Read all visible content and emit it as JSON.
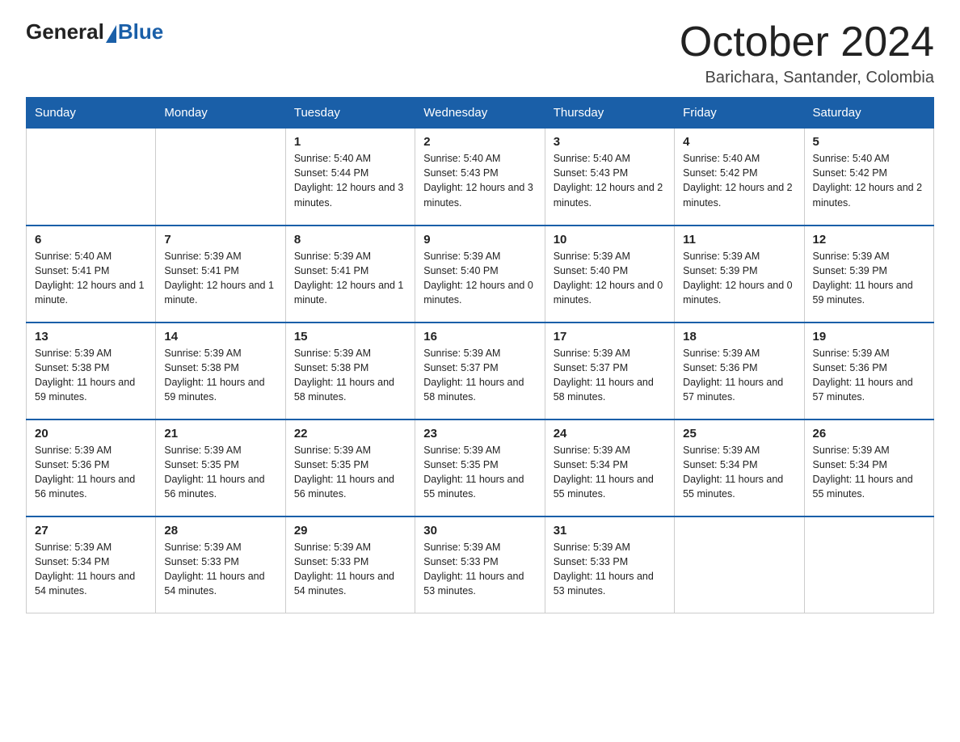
{
  "logo": {
    "general": "General",
    "blue": "Blue"
  },
  "title": "October 2024",
  "location": "Barichara, Santander, Colombia",
  "weekdays": [
    "Sunday",
    "Monday",
    "Tuesday",
    "Wednesday",
    "Thursday",
    "Friday",
    "Saturday"
  ],
  "weeks": [
    [
      {
        "day": "",
        "sunrise": "",
        "sunset": "",
        "daylight": ""
      },
      {
        "day": "",
        "sunrise": "",
        "sunset": "",
        "daylight": ""
      },
      {
        "day": "1",
        "sunrise": "Sunrise: 5:40 AM",
        "sunset": "Sunset: 5:44 PM",
        "daylight": "Daylight: 12 hours and 3 minutes."
      },
      {
        "day": "2",
        "sunrise": "Sunrise: 5:40 AM",
        "sunset": "Sunset: 5:43 PM",
        "daylight": "Daylight: 12 hours and 3 minutes."
      },
      {
        "day": "3",
        "sunrise": "Sunrise: 5:40 AM",
        "sunset": "Sunset: 5:43 PM",
        "daylight": "Daylight: 12 hours and 2 minutes."
      },
      {
        "day": "4",
        "sunrise": "Sunrise: 5:40 AM",
        "sunset": "Sunset: 5:42 PM",
        "daylight": "Daylight: 12 hours and 2 minutes."
      },
      {
        "day": "5",
        "sunrise": "Sunrise: 5:40 AM",
        "sunset": "Sunset: 5:42 PM",
        "daylight": "Daylight: 12 hours and 2 minutes."
      }
    ],
    [
      {
        "day": "6",
        "sunrise": "Sunrise: 5:40 AM",
        "sunset": "Sunset: 5:41 PM",
        "daylight": "Daylight: 12 hours and 1 minute."
      },
      {
        "day": "7",
        "sunrise": "Sunrise: 5:39 AM",
        "sunset": "Sunset: 5:41 PM",
        "daylight": "Daylight: 12 hours and 1 minute."
      },
      {
        "day": "8",
        "sunrise": "Sunrise: 5:39 AM",
        "sunset": "Sunset: 5:41 PM",
        "daylight": "Daylight: 12 hours and 1 minute."
      },
      {
        "day": "9",
        "sunrise": "Sunrise: 5:39 AM",
        "sunset": "Sunset: 5:40 PM",
        "daylight": "Daylight: 12 hours and 0 minutes."
      },
      {
        "day": "10",
        "sunrise": "Sunrise: 5:39 AM",
        "sunset": "Sunset: 5:40 PM",
        "daylight": "Daylight: 12 hours and 0 minutes."
      },
      {
        "day": "11",
        "sunrise": "Sunrise: 5:39 AM",
        "sunset": "Sunset: 5:39 PM",
        "daylight": "Daylight: 12 hours and 0 minutes."
      },
      {
        "day": "12",
        "sunrise": "Sunrise: 5:39 AM",
        "sunset": "Sunset: 5:39 PM",
        "daylight": "Daylight: 11 hours and 59 minutes."
      }
    ],
    [
      {
        "day": "13",
        "sunrise": "Sunrise: 5:39 AM",
        "sunset": "Sunset: 5:38 PM",
        "daylight": "Daylight: 11 hours and 59 minutes."
      },
      {
        "day": "14",
        "sunrise": "Sunrise: 5:39 AM",
        "sunset": "Sunset: 5:38 PM",
        "daylight": "Daylight: 11 hours and 59 minutes."
      },
      {
        "day": "15",
        "sunrise": "Sunrise: 5:39 AM",
        "sunset": "Sunset: 5:38 PM",
        "daylight": "Daylight: 11 hours and 58 minutes."
      },
      {
        "day": "16",
        "sunrise": "Sunrise: 5:39 AM",
        "sunset": "Sunset: 5:37 PM",
        "daylight": "Daylight: 11 hours and 58 minutes."
      },
      {
        "day": "17",
        "sunrise": "Sunrise: 5:39 AM",
        "sunset": "Sunset: 5:37 PM",
        "daylight": "Daylight: 11 hours and 58 minutes."
      },
      {
        "day": "18",
        "sunrise": "Sunrise: 5:39 AM",
        "sunset": "Sunset: 5:36 PM",
        "daylight": "Daylight: 11 hours and 57 minutes."
      },
      {
        "day": "19",
        "sunrise": "Sunrise: 5:39 AM",
        "sunset": "Sunset: 5:36 PM",
        "daylight": "Daylight: 11 hours and 57 minutes."
      }
    ],
    [
      {
        "day": "20",
        "sunrise": "Sunrise: 5:39 AM",
        "sunset": "Sunset: 5:36 PM",
        "daylight": "Daylight: 11 hours and 56 minutes."
      },
      {
        "day": "21",
        "sunrise": "Sunrise: 5:39 AM",
        "sunset": "Sunset: 5:35 PM",
        "daylight": "Daylight: 11 hours and 56 minutes."
      },
      {
        "day": "22",
        "sunrise": "Sunrise: 5:39 AM",
        "sunset": "Sunset: 5:35 PM",
        "daylight": "Daylight: 11 hours and 56 minutes."
      },
      {
        "day": "23",
        "sunrise": "Sunrise: 5:39 AM",
        "sunset": "Sunset: 5:35 PM",
        "daylight": "Daylight: 11 hours and 55 minutes."
      },
      {
        "day": "24",
        "sunrise": "Sunrise: 5:39 AM",
        "sunset": "Sunset: 5:34 PM",
        "daylight": "Daylight: 11 hours and 55 minutes."
      },
      {
        "day": "25",
        "sunrise": "Sunrise: 5:39 AM",
        "sunset": "Sunset: 5:34 PM",
        "daylight": "Daylight: 11 hours and 55 minutes."
      },
      {
        "day": "26",
        "sunrise": "Sunrise: 5:39 AM",
        "sunset": "Sunset: 5:34 PM",
        "daylight": "Daylight: 11 hours and 55 minutes."
      }
    ],
    [
      {
        "day": "27",
        "sunrise": "Sunrise: 5:39 AM",
        "sunset": "Sunset: 5:34 PM",
        "daylight": "Daylight: 11 hours and 54 minutes."
      },
      {
        "day": "28",
        "sunrise": "Sunrise: 5:39 AM",
        "sunset": "Sunset: 5:33 PM",
        "daylight": "Daylight: 11 hours and 54 minutes."
      },
      {
        "day": "29",
        "sunrise": "Sunrise: 5:39 AM",
        "sunset": "Sunset: 5:33 PM",
        "daylight": "Daylight: 11 hours and 54 minutes."
      },
      {
        "day": "30",
        "sunrise": "Sunrise: 5:39 AM",
        "sunset": "Sunset: 5:33 PM",
        "daylight": "Daylight: 11 hours and 53 minutes."
      },
      {
        "day": "31",
        "sunrise": "Sunrise: 5:39 AM",
        "sunset": "Sunset: 5:33 PM",
        "daylight": "Daylight: 11 hours and 53 minutes."
      },
      {
        "day": "",
        "sunrise": "",
        "sunset": "",
        "daylight": ""
      },
      {
        "day": "",
        "sunrise": "",
        "sunset": "",
        "daylight": ""
      }
    ]
  ]
}
